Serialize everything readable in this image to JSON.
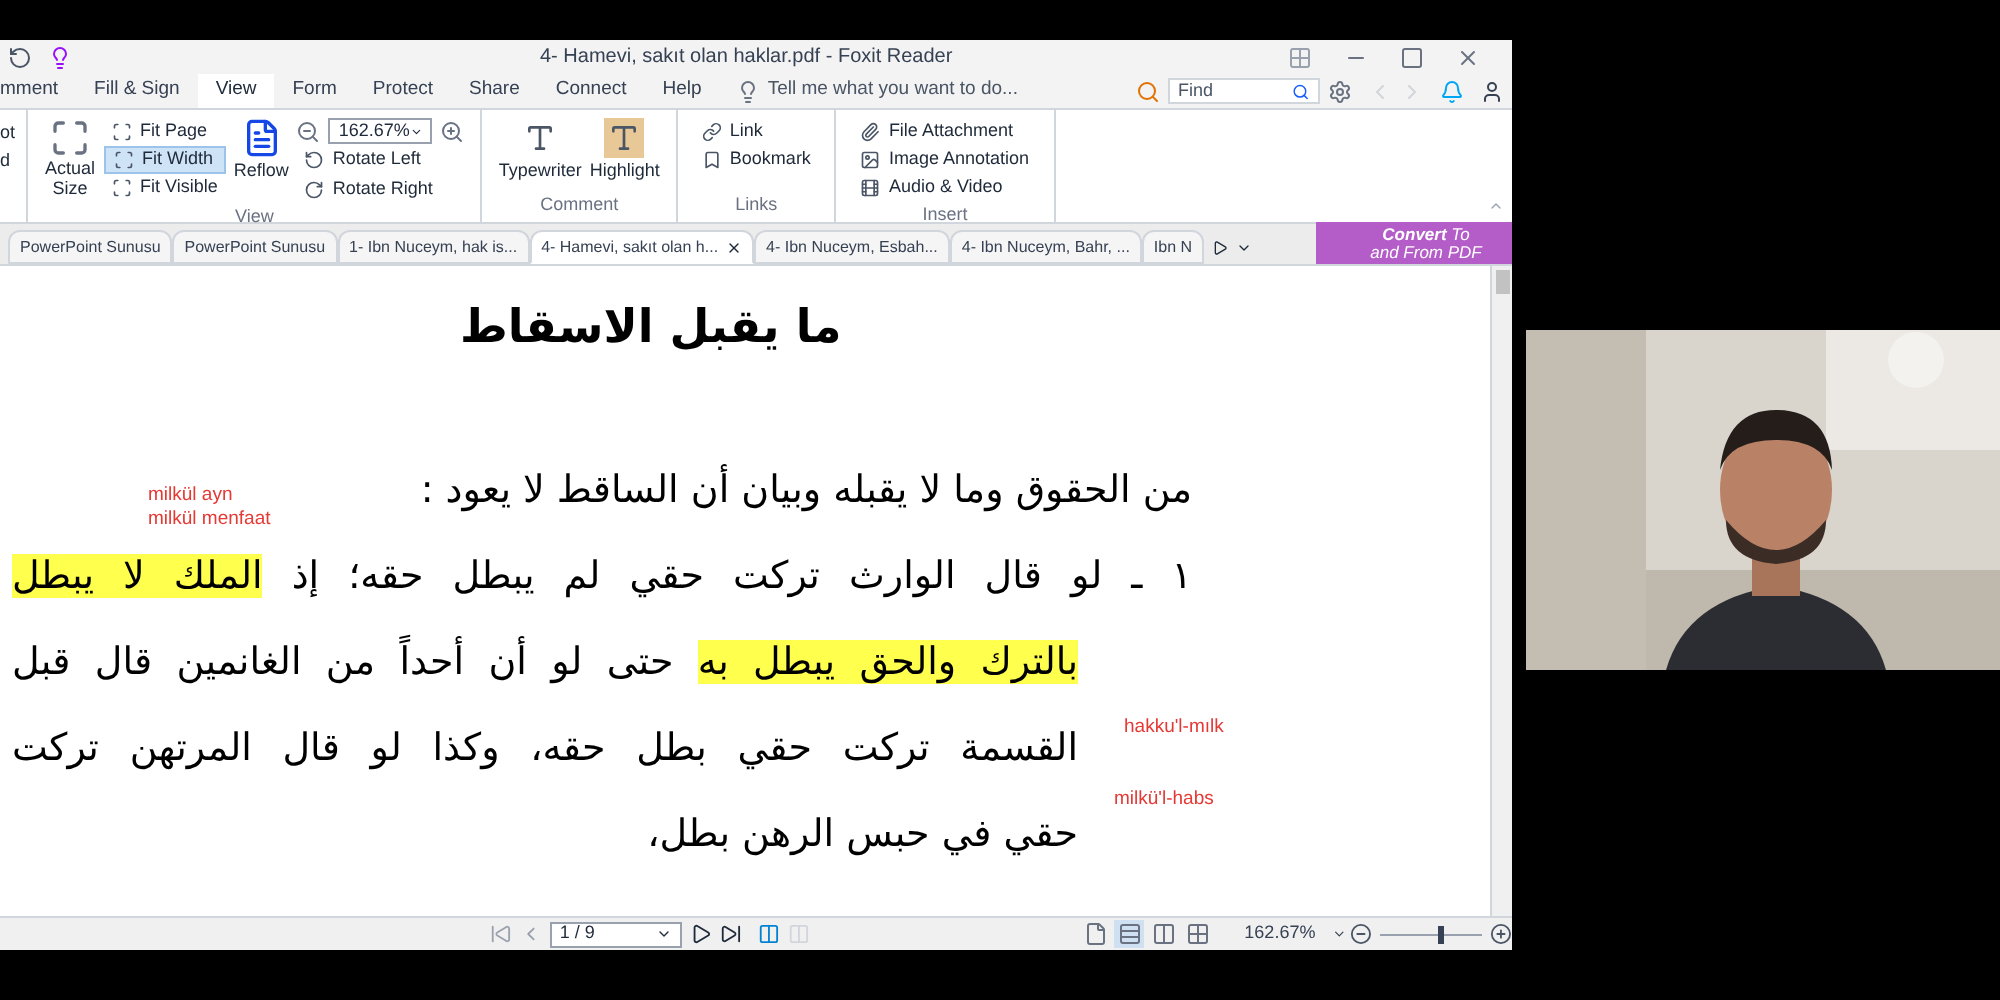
{
  "window": {
    "title": "4- Hamevi, sakıt olan haklar.pdf - Foxit Reader"
  },
  "menu_tabs": [
    {
      "label": "mment",
      "selected": false
    },
    {
      "label": "Fill & Sign",
      "selected": false
    },
    {
      "label": "View",
      "selected": true
    },
    {
      "label": "Form",
      "selected": false
    },
    {
      "label": "Protect",
      "selected": false
    },
    {
      "label": "Share",
      "selected": false
    },
    {
      "label": "Connect",
      "selected": false
    },
    {
      "label": "Help",
      "selected": false
    }
  ],
  "tell_me": {
    "placeholder": "Tell me what you want to do..."
  },
  "find": {
    "placeholder": "Find"
  },
  "ribbon": {
    "edge_items": [
      "ot",
      "d"
    ],
    "view": {
      "label": "View",
      "actual_size": "Actual Size",
      "fit": [
        {
          "label": "Fit Page",
          "selected": false
        },
        {
          "label": "Fit Width",
          "selected": true
        },
        {
          "label": "Fit Visible",
          "selected": false
        }
      ],
      "reflow": "Reflow",
      "zoom": "162.67%",
      "rotate": [
        "Rotate Left",
        "Rotate Right"
      ]
    },
    "comment": {
      "label": "Comment",
      "tools": [
        {
          "label": "Typewriter",
          "selected": false
        },
        {
          "label": "Highlight",
          "selected": true
        }
      ]
    },
    "links": {
      "label": "Links",
      "items": [
        "Link",
        "Bookmark"
      ]
    },
    "insert": {
      "label": "Insert",
      "items": [
        "File Attachment",
        "Image Annotation",
        "Audio & Video"
      ]
    }
  },
  "doc_tabs": [
    {
      "label": "PowerPoint Sunusu",
      "selected": false
    },
    {
      "label": "PowerPoint Sunusu",
      "selected": false
    },
    {
      "label": "1- Ibn Nuceym, hak is...",
      "selected": false
    },
    {
      "label": "4- Hamevi, sakıt olan h...",
      "selected": true
    },
    {
      "label": "4- Ibn Nuceym, Esbah...",
      "selected": false
    },
    {
      "label": "4- Ibn Nuceym, Bahr, ...",
      "selected": false
    },
    {
      "label": "Ibn N",
      "selected": false
    }
  ],
  "convert": {
    "line1": "**Convert** To",
    "line2": "and From PDF"
  },
  "document": {
    "heading": "ما يقبل الاسقاط",
    "lines": [
      {
        "kind": "intro",
        "segments": [
          {
            "text": "من الحقوق وما لا يقبله وبيان أن الساقط لا يعود :",
            "highlight": false
          }
        ]
      },
      {
        "kind": "first",
        "segments": [
          {
            "text": "١ ـ لو قال الوارث تركت حقي لم يبطل حقه؛ إذ ",
            "highlight": false
          },
          {
            "text": "الملك لا يبطل",
            "highlight": true
          }
        ]
      },
      {
        "kind": "cont",
        "segments": [
          {
            "text": "بالترك والحق يبطل به",
            "highlight": true
          },
          {
            "text": " حتى لو أن أحداً من الغانمين قال قبل",
            "highlight": false
          }
        ]
      },
      {
        "kind": "cont",
        "segments": [
          {
            "text": "القسمة تركت حقي بطل حقه، وكذا لو قال المرتهن تركت",
            "highlight": false
          }
        ]
      },
      {
        "kind": "end",
        "segments": [
          {
            "text": "حقي في حبس الرهن بطل،",
            "highlight": false
          }
        ]
      }
    ],
    "annotations": [
      "milkül ayn",
      "milkül menfaat",
      "hakku'l-mılk",
      "milkü'l-habs"
    ]
  },
  "status_bar": {
    "page": "1 / 9",
    "view_modes": [
      {
        "selected": false
      },
      {
        "selected": true
      },
      {
        "selected": false
      },
      {
        "selected": false
      }
    ],
    "zoom": "162.67%",
    "zoom_slider": {
      "level": 0.58
    }
  }
}
